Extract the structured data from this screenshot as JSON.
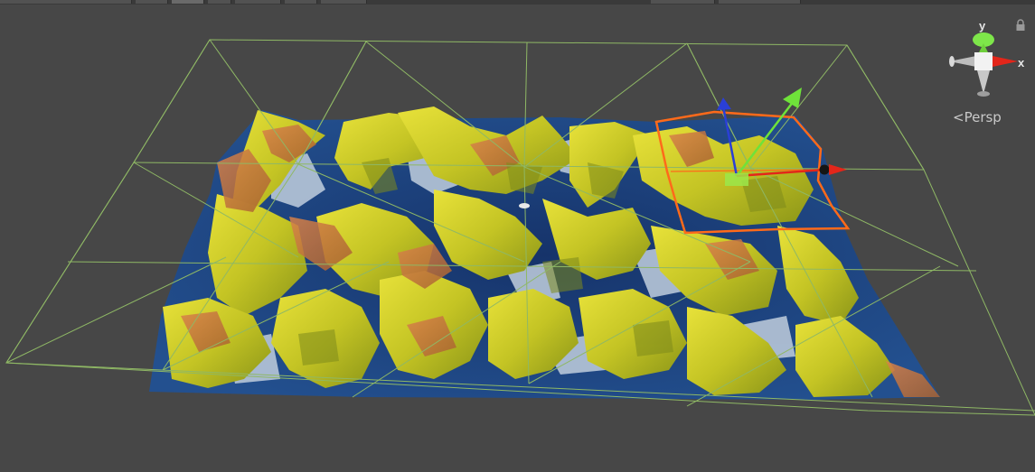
{
  "toolbar": {
    "segments": 9
  },
  "viewport": {
    "background_color": "#474747",
    "projection_label": "Persp",
    "projection_icon": "perspective-chevron-icon"
  },
  "gizmo": {
    "x_label": "x",
    "y_label": "y",
    "x_color": "#e3261a",
    "y_color": "#7ee64a",
    "z_color": "#2a4cd6",
    "lock_icon": "lock-icon"
  },
  "terrain": {
    "water_color": "#1c3f7c",
    "sand_color": "#d8d42c",
    "grass_color": "#8e9a20",
    "rock_color": "#c9753a",
    "foam_color": "#b9c8da"
  },
  "selection": {
    "outline_color": "#ff6a1a",
    "handle_colors": {
      "x": "#e3261a",
      "y": "#6fe23a",
      "z": "#2a3fd6"
    }
  },
  "bounds_wireframe_color": "#8fb865"
}
